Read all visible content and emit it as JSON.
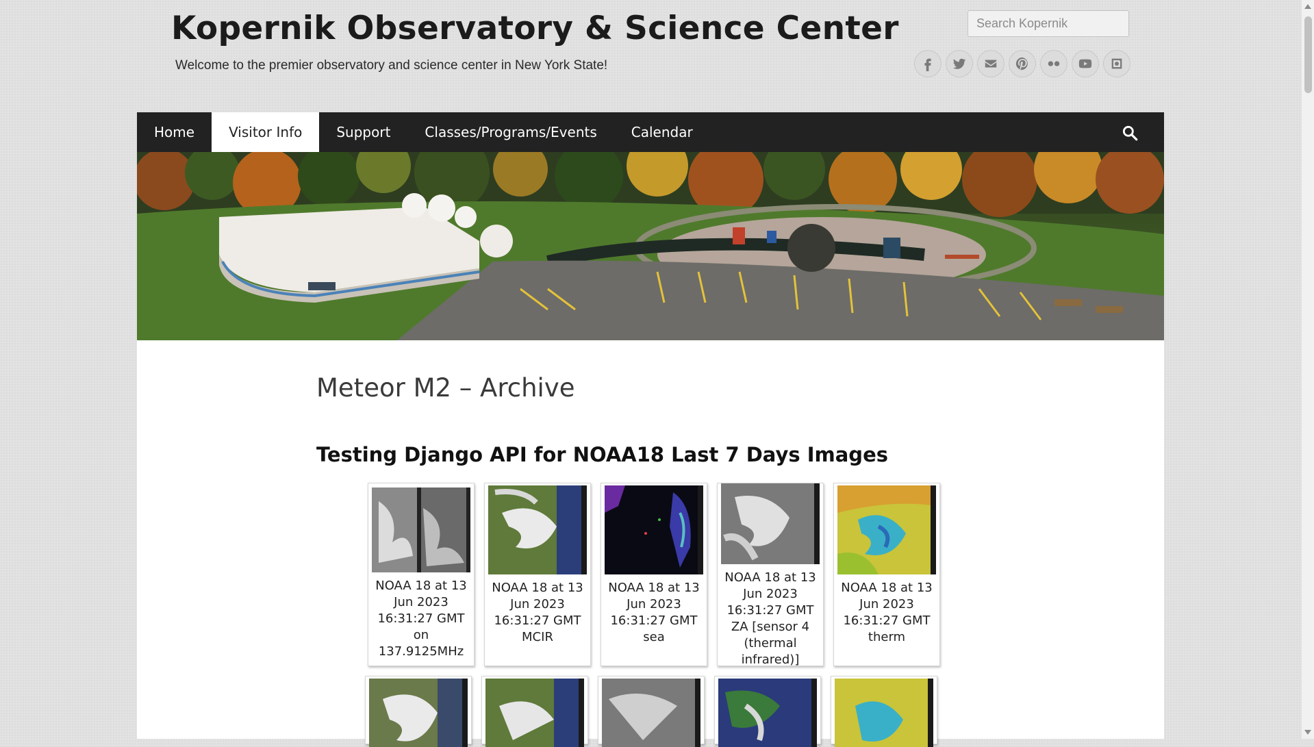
{
  "header": {
    "site_title": "Kopernik Observatory & Science Center",
    "tagline": "Welcome to the premier observatory and science center in New York State!",
    "search_placeholder": "Search Kopernik",
    "social_icons": [
      "facebook-icon",
      "twitter-icon",
      "email-icon",
      "pinterest-icon",
      "flickr-icon",
      "youtube-icon",
      "instagram-icon"
    ]
  },
  "nav": {
    "items": [
      {
        "label": "Home"
      },
      {
        "label": "Visitor Info",
        "active": true
      },
      {
        "label": "Support"
      },
      {
        "label": "Classes/Programs/Events"
      },
      {
        "label": "Calendar"
      }
    ],
    "search_icon": "search-icon"
  },
  "hero": {
    "image_alt": "Aerial view of Kopernik observatory building with domes, playground and parking lot in autumn"
  },
  "main": {
    "page_title": "Meteor M2 – Archive",
    "section_heading": "Testing Django API for NOAA18 Last 7 Days Images",
    "gallery": [
      {
        "caption": "NOAA 18 at 13 Jun 2023 16:31:27 GMT on 137.9125MHz",
        "style": "raw"
      },
      {
        "caption": "NOAA 18 at 13 Jun 2023 16:31:27 GMT MCIR",
        "style": "mcir"
      },
      {
        "caption": "NOAA 18 at 13 Jun 2023 16:31:27 GMT sea",
        "style": "sea"
      },
      {
        "caption": "NOAA 18 at 13 Jun 2023 16:31:27 GMT ZA [sensor 4 (ther­mal infrared)]",
        "style": "za"
      },
      {
        "caption": "NOAA 18 at 13 Jun 2023 16:31:27 GMT therm",
        "style": "therm"
      },
      {
        "caption": "",
        "style": "hvc"
      },
      {
        "caption": "",
        "style": "mcir"
      },
      {
        "caption": "",
        "style": "za"
      },
      {
        "caption": "",
        "style": "msa"
      },
      {
        "caption": "",
        "style": "therm"
      }
    ]
  },
  "colors": {
    "nav_background": "#222222",
    "page_background": "#e2e2e2",
    "content_background": "#ffffff"
  }
}
